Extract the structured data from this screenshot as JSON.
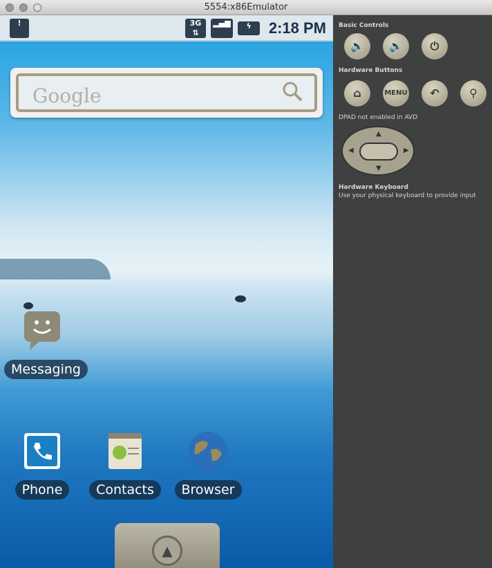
{
  "window": {
    "title": "5554:x86Emulator"
  },
  "status_bar": {
    "time": "2:18 PM",
    "network": "3G"
  },
  "search_widget": {
    "placeholder": "Google"
  },
  "home_apps": [
    {
      "label": "Messaging"
    },
    {
      "label": "Phone"
    },
    {
      "label": "Contacts"
    },
    {
      "label": "Browser"
    }
  ],
  "panel": {
    "basic_controls": "Basic Controls",
    "hardware_buttons": "Hardware Buttons",
    "menu_label": "MENU",
    "dpad_note": "DPAD not enabled in AVD",
    "keyboard_title": "Hardware Keyboard",
    "keyboard_note": "Use your physical keyboard to provide input"
  }
}
